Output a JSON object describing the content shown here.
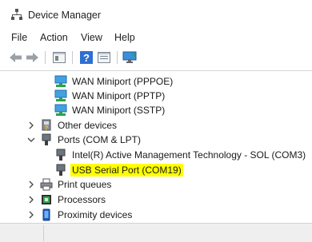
{
  "window": {
    "title": "Device Manager"
  },
  "menu": [
    "File",
    "Action",
    "View",
    "Help"
  ],
  "toolbar": {
    "buttons": [
      "back-icon",
      "forward-icon",
      "show-hide-console-tree-icon",
      "help-icon",
      "properties-icon",
      "monitor-icon"
    ]
  },
  "tree": {
    "wan_pppoe": "WAN Miniport (PPPOE)",
    "wan_pptp": "WAN Miniport (PPTP)",
    "wan_sstp": "WAN Miniport (SSTP)",
    "other_devices": "Other devices",
    "ports": "Ports (COM & LPT)",
    "intel_amt": "Intel(R) Active Management Technology - SOL (COM3)",
    "usb_serial": "USB Serial Port (COM19)",
    "print_queues": "Print queues",
    "processors": "Processors",
    "proximity": "Proximity devices"
  },
  "colors": {
    "highlight": "#ffff00",
    "accent": "#1e6fd9"
  }
}
